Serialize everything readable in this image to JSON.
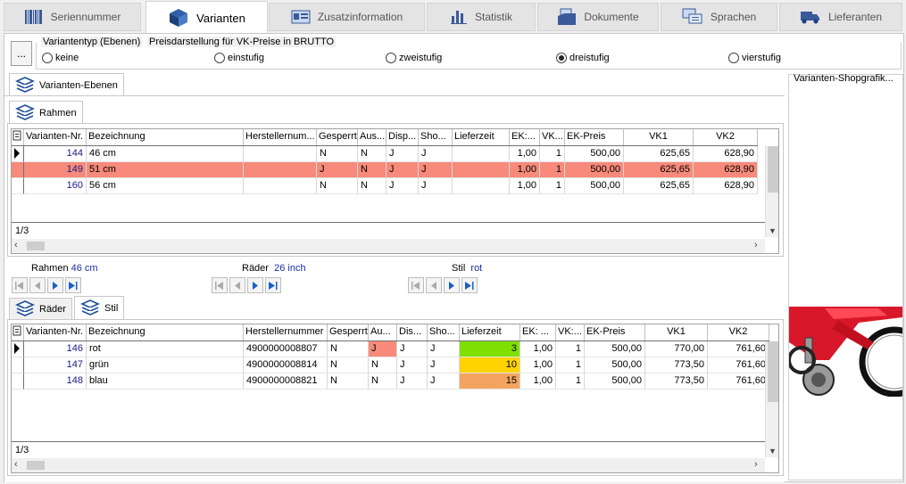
{
  "tabs": [
    {
      "label": "Seriennummer",
      "icon": "barcode-icon"
    },
    {
      "label": "Varianten",
      "icon": "cubes-icon"
    },
    {
      "label": "Zusatzinformation",
      "icon": "id-card-icon"
    },
    {
      "label": "Statistik",
      "icon": "bar-chart-icon"
    },
    {
      "label": "Dokumente",
      "icon": "documents-icon"
    },
    {
      "label": "Sprachen",
      "icon": "speech-bubbles-icon"
    },
    {
      "label": "Lieferanten",
      "icon": "truck-icon"
    }
  ],
  "options": {
    "more_button": "...",
    "group_title": "Variantentyp (Ebenen)",
    "price_display": "Preisdarstellung für VK-Preise in BRUTTO",
    "radios": [
      "keine",
      "einstufig",
      "zweistufig",
      "dreistufig",
      "vierstufig"
    ],
    "selected": "dreistufig"
  },
  "levels_tab": "Varianten-Ebenen",
  "image_panel_title": "Varianten-Shopgrafik...",
  "rahmen_tab": "Rahmen",
  "grid1": {
    "headers": [
      "Varianten-Nr.",
      "Bezeichnung",
      "Herstellernum...",
      "Gesperrt",
      "Aus...",
      "Disp...",
      "Sho...",
      "Lieferzeit",
      "EK:...",
      "VK...",
      "EK-Preis",
      "VK1",
      "VK2"
    ],
    "rows": [
      [
        "144",
        "46 cm",
        "",
        "N",
        "N",
        "J",
        "J",
        "",
        "1,00",
        "1",
        "500,00",
        "625,65",
        "628,90"
      ],
      [
        "149",
        "51 cm",
        "",
        "J",
        "N",
        "J",
        "J",
        "",
        "1,00",
        "1",
        "500,00",
        "625,65",
        "628,90"
      ],
      [
        "160",
        "56 cm",
        "",
        "N",
        "N",
        "J",
        "J",
        "",
        "1,00",
        "1",
        "500,00",
        "625,65",
        "628,90"
      ]
    ],
    "selected_row": 1,
    "footer": "1/3"
  },
  "selectors": [
    {
      "label": "Rahmen",
      "value": "46 cm"
    },
    {
      "label": "Räder",
      "value": "26 inch"
    },
    {
      "label": "Stil",
      "value": "rot"
    }
  ],
  "lower_tabs": [
    "Räder",
    "Stil"
  ],
  "grid2": {
    "headers": [
      "Varianten-Nr.",
      "Bezeichnung",
      "Herstellernummer",
      "Gesperrt",
      "Au...",
      "Dis...",
      "Sho...",
      "Lieferzeit",
      "EK: ...",
      "VK:...",
      "EK-Preis",
      "VK1",
      "VK2"
    ],
    "rows": [
      [
        "146",
        "rot",
        "4900000008807",
        "N",
        "J",
        "J",
        "J",
        "3",
        "1,00",
        "1",
        "500,00",
        "770,00",
        "761,60"
      ],
      [
        "147",
        "grün",
        "4900000008814",
        "N",
        "N",
        "J",
        "J",
        "10",
        "1,00",
        "1",
        "500,00",
        "773,50",
        "761,60"
      ],
      [
        "148",
        "blau",
        "4900000008821",
        "N",
        "N",
        "J",
        "J",
        "15",
        "1,00",
        "1",
        "500,00",
        "773,50",
        "761,60"
      ]
    ],
    "footer": "1/3"
  },
  "colors": {
    "selected_row": "#f78a7a",
    "lieferzeit_green": "#7fe000",
    "lieferzeit_yellow": "#ffd200",
    "lieferzeit_orange": "#f4a460",
    "bike_red": "#d8182a"
  }
}
